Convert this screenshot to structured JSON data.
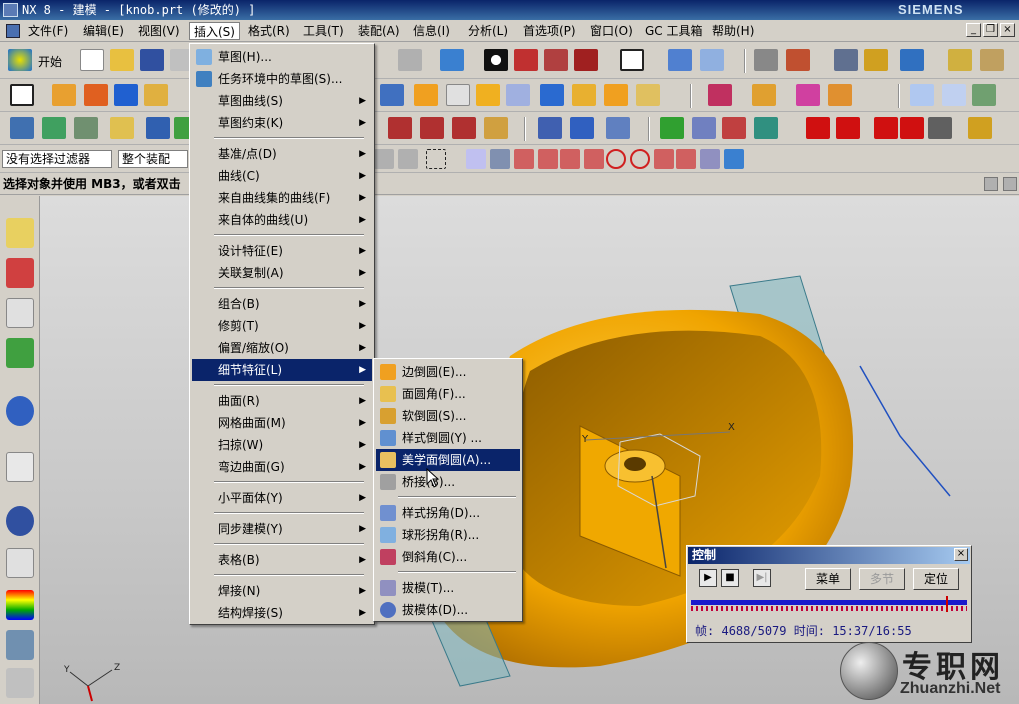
{
  "window": {
    "title": "NX 8 - 建模 - [knob.prt (修改的) ]",
    "brand": "SIEMENS",
    "controls": [
      "_",
      "❐",
      "×"
    ]
  },
  "menubar": [
    "文件(F)",
    "编辑(E)",
    "视图(V)",
    "插入(S)",
    "格式(R)",
    "工具(T)",
    "装配(A)",
    "信息(I)",
    "分析(L)",
    "首选项(P)",
    "窗口(O)",
    "GC 工具箱",
    "帮助(H)"
  ],
  "toolbar": {
    "start_label": "开始",
    "filter_value": "没有选择过滤器",
    "scope_value": "整个装配"
  },
  "status": {
    "prompt": "选择对象并使用 MB3，或者双击"
  },
  "insert_menu": [
    {
      "label": "草图(H)...",
      "arrow": false
    },
    {
      "label": "任务环境中的草图(S)...",
      "arrow": false
    },
    {
      "label": "草图曲线(S)",
      "arrow": true
    },
    {
      "label": "草图约束(K)",
      "arrow": true
    },
    {
      "label": "基准/点(D)",
      "arrow": true
    },
    {
      "label": "曲线(C)",
      "arrow": true
    },
    {
      "label": "来自曲线集的曲线(F)",
      "arrow": true
    },
    {
      "label": "来自体的曲线(U)",
      "arrow": true
    },
    {
      "label": "设计特征(E)",
      "arrow": true
    },
    {
      "label": "关联复制(A)",
      "arrow": true
    },
    {
      "label": "组合(B)",
      "arrow": true
    },
    {
      "label": "修剪(T)",
      "arrow": true
    },
    {
      "label": "偏置/缩放(O)",
      "arrow": true
    },
    {
      "label": "细节特征(L)",
      "arrow": true
    },
    {
      "label": "曲面(R)",
      "arrow": true
    },
    {
      "label": "网格曲面(M)",
      "arrow": true
    },
    {
      "label": "扫掠(W)",
      "arrow": true
    },
    {
      "label": "弯边曲面(G)",
      "arrow": true
    },
    {
      "label": "小平面体(Y)",
      "arrow": true
    },
    {
      "label": "同步建模(Y)",
      "arrow": true
    },
    {
      "label": "表格(B)",
      "arrow": true
    },
    {
      "label": "焊接(N)",
      "arrow": true
    },
    {
      "label": "结构焊接(S)",
      "arrow": true
    }
  ],
  "detail_submenu": [
    {
      "label": "边倒圆(E)..."
    },
    {
      "label": "面圆角(F)..."
    },
    {
      "label": "软倒圆(S)..."
    },
    {
      "label": "样式倒圆(Y) ..."
    },
    {
      "label": "美学面倒圆(A)..."
    },
    {
      "label": "桥接(B)..."
    },
    {
      "label": "样式拐角(D)..."
    },
    {
      "label": "球形拐角(R)..."
    },
    {
      "label": "倒斜角(C)..."
    },
    {
      "label": "拔模(T)..."
    },
    {
      "label": "拔模体(D)..."
    }
  ],
  "control_panel": {
    "title": "控制",
    "menu_button": "菜单",
    "multistep_button": "多节",
    "position_button": "定位",
    "frame_label": "帧:",
    "frame": "4688/5079",
    "time_label": "时间:",
    "time": "15:37/16:55",
    "progress": 0.923
  },
  "watermark": {
    "chinese": "专职网",
    "domain": "Zhuanzhi.Net"
  },
  "colors": {
    "menu_highlight": "#0a246a",
    "model_orange": "#f0a400",
    "plane_teal": "#7fb8c0"
  }
}
